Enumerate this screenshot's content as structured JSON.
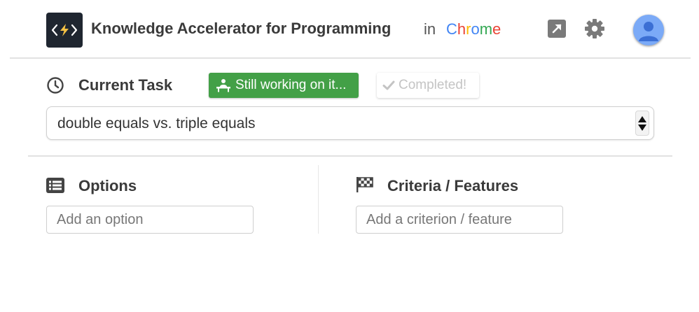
{
  "header": {
    "app_title": "Knowledge Accelerator for Programming",
    "in_text": "in",
    "browser_letters": [
      {
        "ch": "C",
        "color": "#4285f4"
      },
      {
        "ch": "h",
        "color": "#ea4335"
      },
      {
        "ch": "r",
        "color": "#fbbc05"
      },
      {
        "ch": "o",
        "color": "#4285f4"
      },
      {
        "ch": "m",
        "color": "#34a853"
      },
      {
        "ch": "e",
        "color": "#ea4335"
      }
    ],
    "icons": {
      "logo": "code-bolt-icon",
      "open_external": "open-external-icon",
      "settings": "gear-icon",
      "avatar": "user-avatar-icon"
    }
  },
  "current_task": {
    "title": "Current Task",
    "icon": "clock-icon",
    "still_working_label": "Still working on it...",
    "still_working_icon": "person-at-desk-icon",
    "completed_label": "Completed!",
    "completed_icon": "checkmark-icon",
    "selected_task": "double equals vs. triple equals"
  },
  "options": {
    "title": "Options",
    "icon": "list-icon",
    "placeholder": "Add an option"
  },
  "criteria": {
    "title": "Criteria / Features",
    "icon": "checkered-flag-icon",
    "placeholder": "Add a criterion / feature"
  },
  "colors": {
    "working_green": "#43a047",
    "logo_bg": "#1f2630",
    "avatar_blue": "#7baaf7",
    "avatar_figure": "#3b6fd4"
  }
}
